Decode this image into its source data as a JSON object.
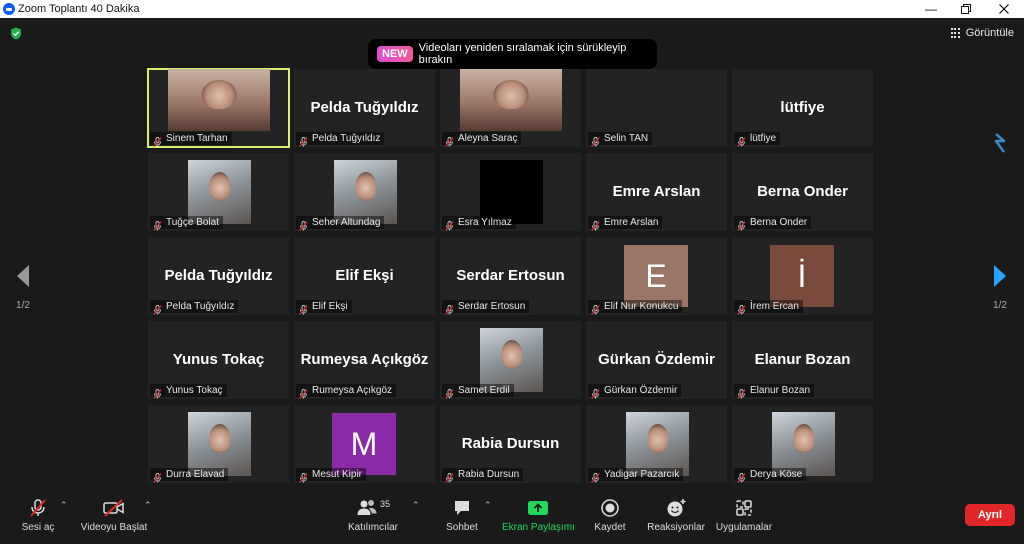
{
  "window": {
    "title": "Zoom Toplantı 40 Dakika"
  },
  "banner": {
    "badge": "NEW",
    "message": "Videoları yeniden sıralamak için sürükleyip bırakın"
  },
  "view_button": {
    "label": "Görüntüle"
  },
  "pager": {
    "left": "1/2",
    "right": "1/2"
  },
  "colors": {
    "active_border": "#d7f06a",
    "tile_bg": "#232323",
    "end_button": "#e02828",
    "share_green": "#23d959"
  },
  "participants": [
    {
      "name": "Sinem Tarhan",
      "display": "video"
    },
    {
      "name": "Pelda Tuğyıldız",
      "display": "text"
    },
    {
      "name": "Aleyna Saraç",
      "display": "video"
    },
    {
      "name": "Selin TAN",
      "display": "empty"
    },
    {
      "name": "lütfiye",
      "display": "text"
    },
    {
      "name": "Tuğçe Bolat",
      "display": "photo"
    },
    {
      "name": "Seher Altundag",
      "display": "photo"
    },
    {
      "name": "Esra Yılmaz",
      "display": "black"
    },
    {
      "name": "Emre Arslan",
      "display": "text"
    },
    {
      "name": "Berna Onder",
      "display": "text"
    },
    {
      "name": "Pelda Tuğyıldız",
      "display": "text"
    },
    {
      "name": "Elif Ekşi",
      "display": "text"
    },
    {
      "name": "Serdar Ertosun",
      "display": "text"
    },
    {
      "name": "Elif Nur Konukcu",
      "display": "letter",
      "letter": "E",
      "color": "#9b7565"
    },
    {
      "name": "İrem Ercan",
      "display": "letter",
      "letter": "İ",
      "color": "#7a4b3c"
    },
    {
      "name": "Yunus Tokaç",
      "display": "text"
    },
    {
      "name": "Rumeysa Açıkgöz",
      "display": "text"
    },
    {
      "name": "Samet Erdil",
      "display": "photo"
    },
    {
      "name": "Gürkan Özdemir",
      "display": "text"
    },
    {
      "name": "Elanur Bozan",
      "display": "text"
    },
    {
      "name": "Durra Elavad",
      "display": "photo"
    },
    {
      "name": "Mesut Kipir",
      "display": "letter",
      "letter": "M",
      "color": "#8a2aa8"
    },
    {
      "name": "Rabia Dursun",
      "display": "text"
    },
    {
      "name": "Yadigar Pazarcık",
      "display": "photo"
    },
    {
      "name": "Derya Köse",
      "display": "photo"
    }
  ],
  "toolbar": {
    "unmute": "Sesi aç",
    "start_video": "Videoyu Başlat",
    "participants": "Katılımcılar",
    "participants_count": "35",
    "chat": "Sohbet",
    "share": "Ekran Paylaşımı",
    "record": "Kaydet",
    "reactions": "Reaksiyonlar",
    "apps": "Uygulamalar",
    "end": "Ayrıl"
  }
}
